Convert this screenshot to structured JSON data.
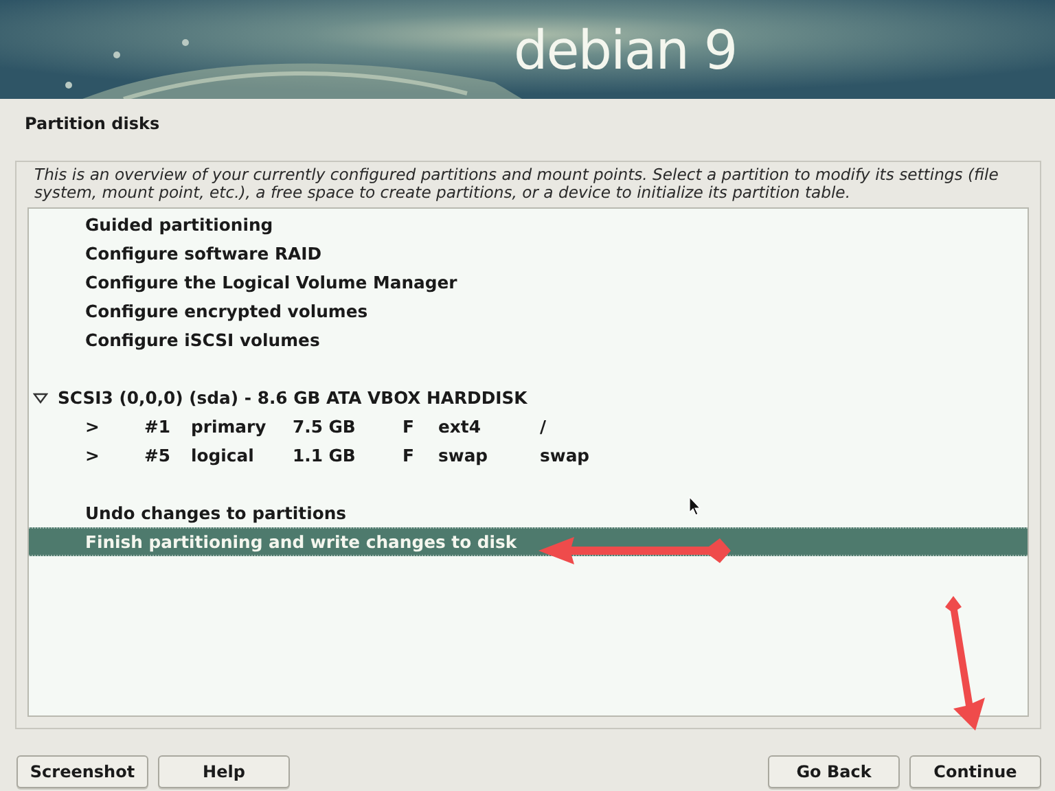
{
  "banner": {
    "logo": "debian 9"
  },
  "page_title": "Partition disks",
  "description": "This is an overview of your currently configured partitions and mount points. Select a partition to modify its settings (file system, mount point, etc.), a free space to create partitions, or a device to initialize its partition table.",
  "items": [
    {
      "kind": "action",
      "label": "Guided partitioning",
      "selected": false
    },
    {
      "kind": "action",
      "label": "Configure software RAID",
      "selected": false
    },
    {
      "kind": "action",
      "label": "Configure the Logical Volume Manager",
      "selected": false
    },
    {
      "kind": "action",
      "label": "Configure encrypted volumes",
      "selected": false
    },
    {
      "kind": "action",
      "label": "Configure iSCSI volumes",
      "selected": false
    },
    {
      "kind": "blank"
    },
    {
      "kind": "disk",
      "label": "SCSI3 (0,0,0) (sda) - 8.6 GB ATA VBOX HARDDISK",
      "expanded": true,
      "selected": false
    },
    {
      "kind": "partition",
      "marker": ">",
      "number": "#1",
      "type": "primary",
      "size": "7.5 GB",
      "format": "F",
      "filesystem": "ext4",
      "mount": "/",
      "selected": false
    },
    {
      "kind": "partition",
      "marker": ">",
      "number": "#5",
      "type": "logical",
      "size": "1.1 GB",
      "format": "F",
      "filesystem": "swap",
      "mount": "swap",
      "selected": false
    },
    {
      "kind": "blank"
    },
    {
      "kind": "action",
      "label": "Undo changes to partitions",
      "selected": false
    },
    {
      "kind": "action",
      "label": "Finish partitioning and write changes to disk",
      "selected": true
    }
  ],
  "buttons_left": [
    "Screenshot",
    "Help"
  ],
  "buttons_right": [
    "Go Back",
    "Continue"
  ]
}
